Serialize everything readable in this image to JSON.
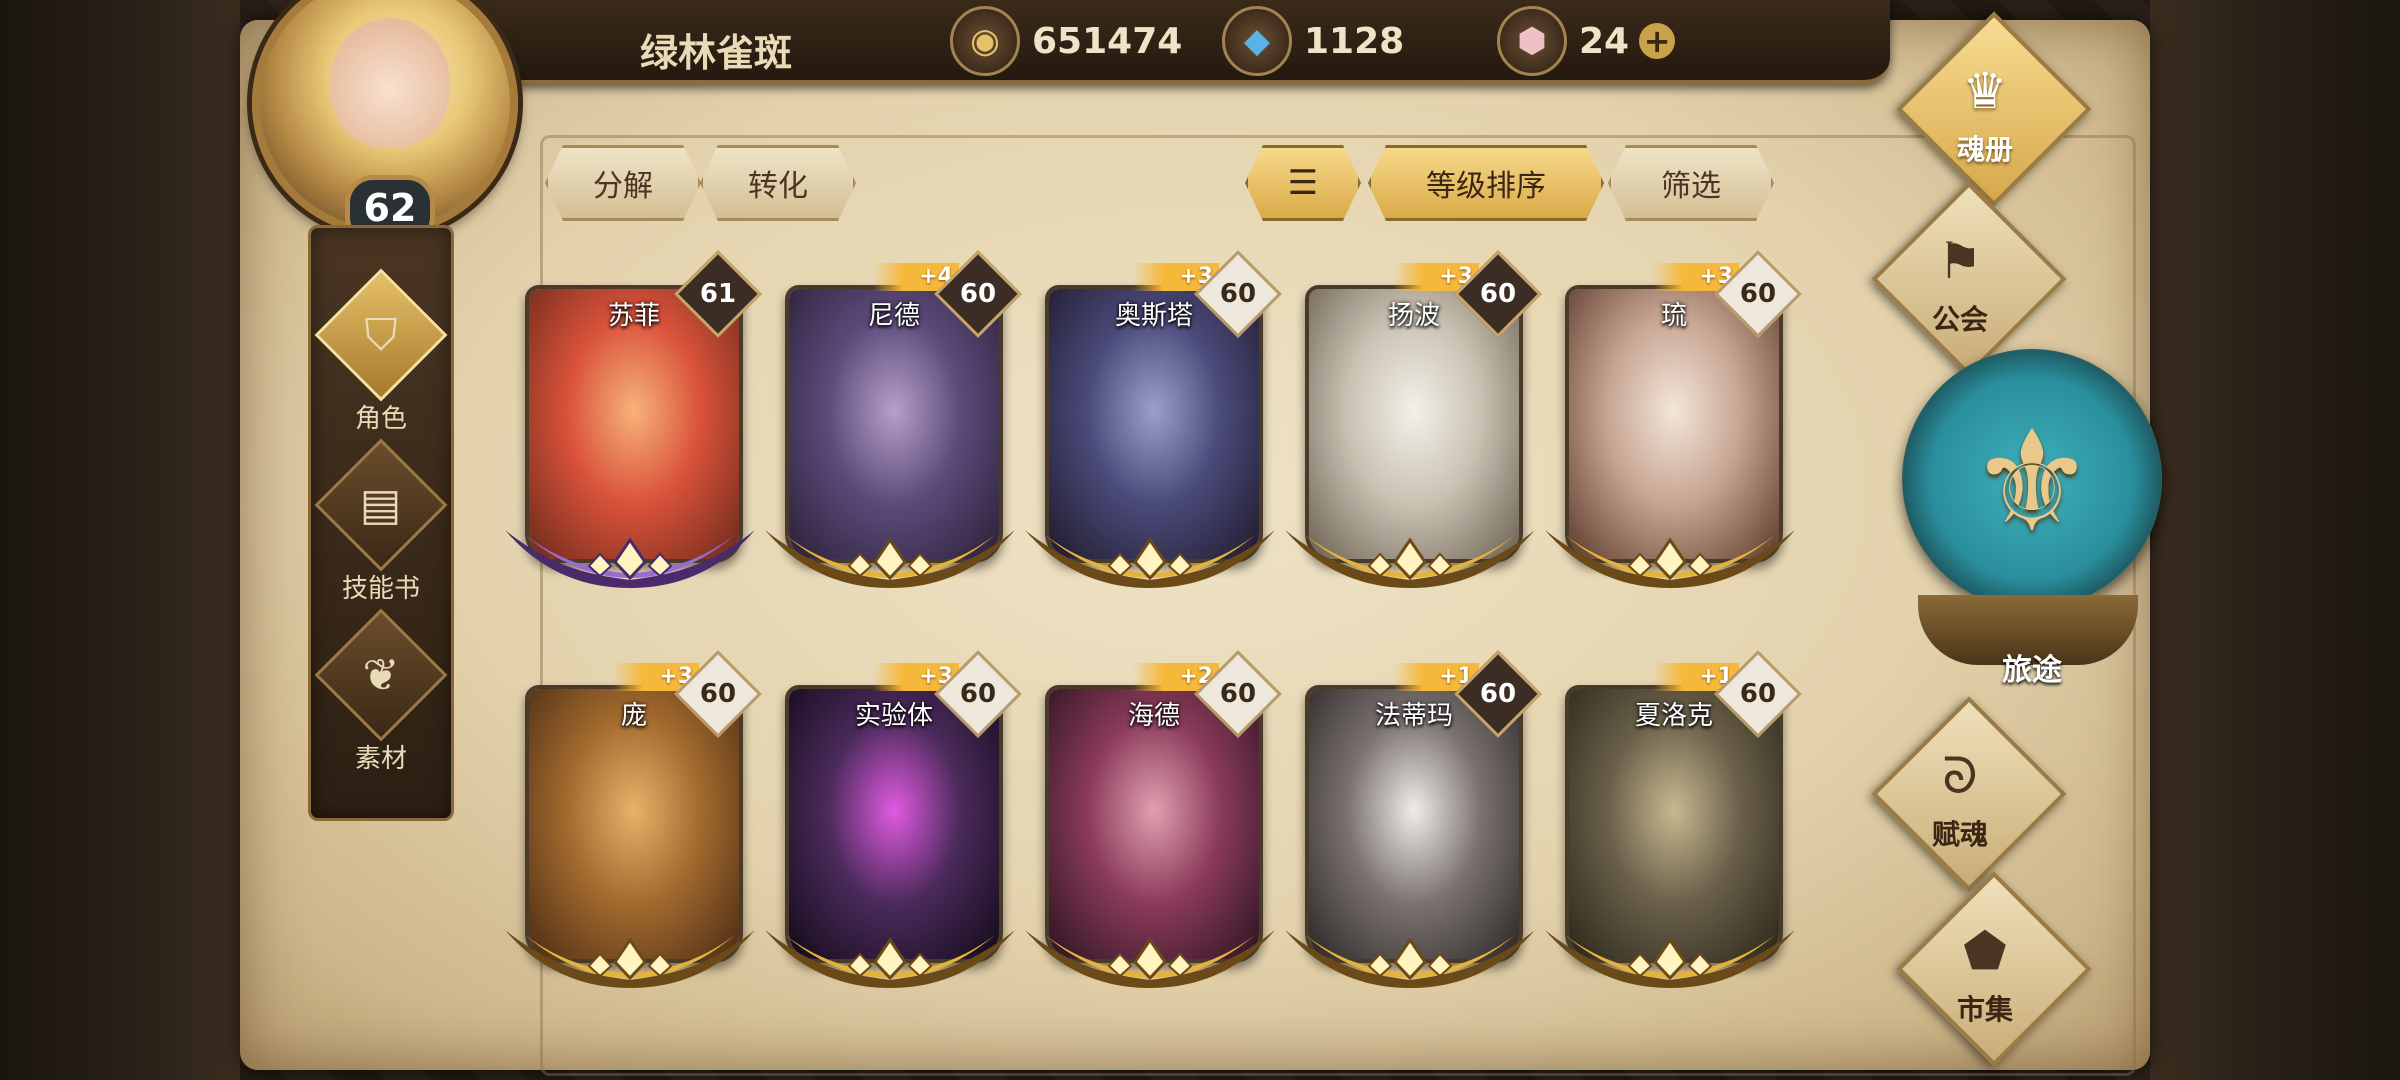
{
  "player": {
    "name": "绿林雀斑",
    "level": "62"
  },
  "resources": {
    "gold": "651474",
    "crystal": "1128",
    "gem": "24"
  },
  "left_nav": [
    {
      "label": "角色",
      "icon": "helmet-icon"
    },
    {
      "label": "技能书",
      "icon": "skill-book-icon"
    },
    {
      "label": "素材",
      "icon": "material-icon"
    }
  ],
  "toolbar": {
    "decompose": "分解",
    "convert": "转化",
    "sort_label": "等级排序",
    "filter": "筛选"
  },
  "heroes": [
    {
      "name": "苏菲",
      "level": "61",
      "plus": "",
      "colors": [
        "#f7b27a",
        "#d9523a",
        "#6b2a1a"
      ]
    },
    {
      "name": "尼德",
      "level": "60",
      "plus": "+4",
      "colors": [
        "#b7a0c8",
        "#5b4a7a",
        "#2b2036"
      ]
    },
    {
      "name": "奥斯塔",
      "level": "60",
      "plus": "+3",
      "colors": [
        "#9aa0c8",
        "#4a4a7a",
        "#1f1a2a"
      ]
    },
    {
      "name": "扬波",
      "level": "60",
      "plus": "+3",
      "colors": [
        "#f4f0e8",
        "#c9c2b3",
        "#6a6052"
      ]
    },
    {
      "name": "琉",
      "level": "60",
      "plus": "+3",
      "colors": [
        "#f3e6da",
        "#c7a592",
        "#5a3a2a"
      ]
    },
    {
      "name": "庞",
      "level": "60",
      "plus": "+3",
      "colors": [
        "#e7b26a",
        "#a36a2e",
        "#4a2c14"
      ]
    },
    {
      "name": "实验体",
      "level": "60",
      "plus": "+3",
      "colors": [
        "#e05ae0",
        "#4a2a5a",
        "#120a18"
      ]
    },
    {
      "name": "海德",
      "level": "60",
      "plus": "+2",
      "colors": [
        "#e0a0b0",
        "#8a3a5a",
        "#2a1420"
      ]
    },
    {
      "name": "法蒂玛",
      "level": "60",
      "plus": "+1",
      "colors": [
        "#f0ece6",
        "#7a7270",
        "#2a2624"
      ]
    },
    {
      "name": "夏洛克",
      "level": "60",
      "plus": "+1",
      "colors": [
        "#c8b890",
        "#6a604a",
        "#2a261a"
      ]
    }
  ],
  "right_menu": [
    {
      "label": "魂册",
      "icon": "soul-book-icon"
    },
    {
      "label": "公会",
      "icon": "guild-icon"
    },
    {
      "label": "旅途",
      "icon": "journey-icon"
    },
    {
      "label": "赋魂",
      "icon": "flame-icon"
    },
    {
      "label": "市集",
      "icon": "market-icon"
    }
  ]
}
